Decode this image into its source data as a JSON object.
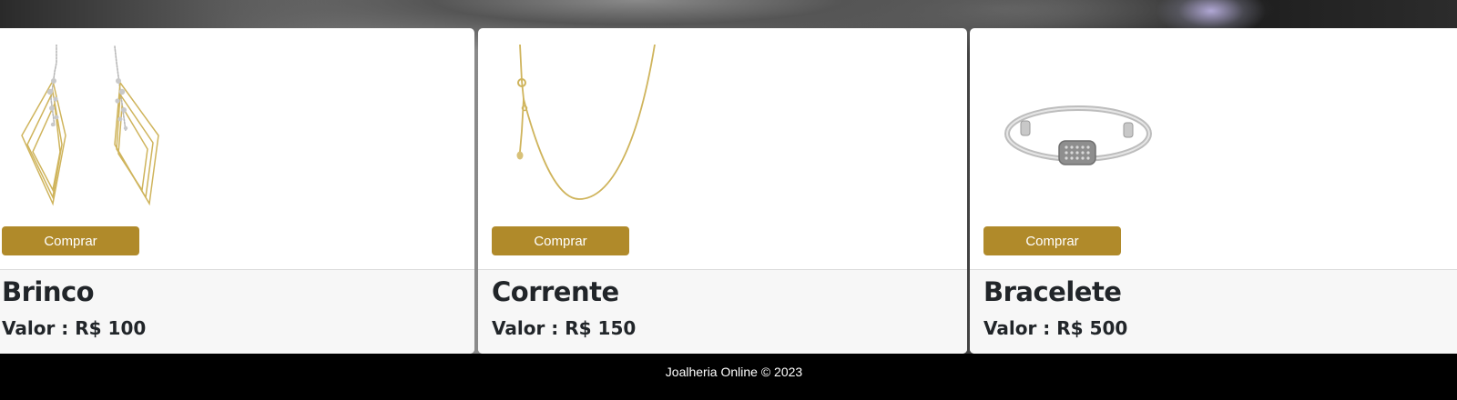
{
  "products": [
    {
      "title": "Brinco",
      "price": "Valor : R$ 100",
      "button_label": "Comprar",
      "icon": "earrings-icon"
    },
    {
      "title": "Corrente",
      "price": "Valor : R$ 150",
      "button_label": "Comprar",
      "icon": "necklace-icon"
    },
    {
      "title": "Bracelete",
      "price": "Valor : R$ 500",
      "button_label": "Comprar",
      "icon": "bracelet-icon"
    }
  ],
  "footer": {
    "text": "Joalheria Online © 2023"
  },
  "colors": {
    "accent": "#b08a2a",
    "card_footer_bg": "#f7f7f7",
    "page_footer_bg": "#000000"
  }
}
